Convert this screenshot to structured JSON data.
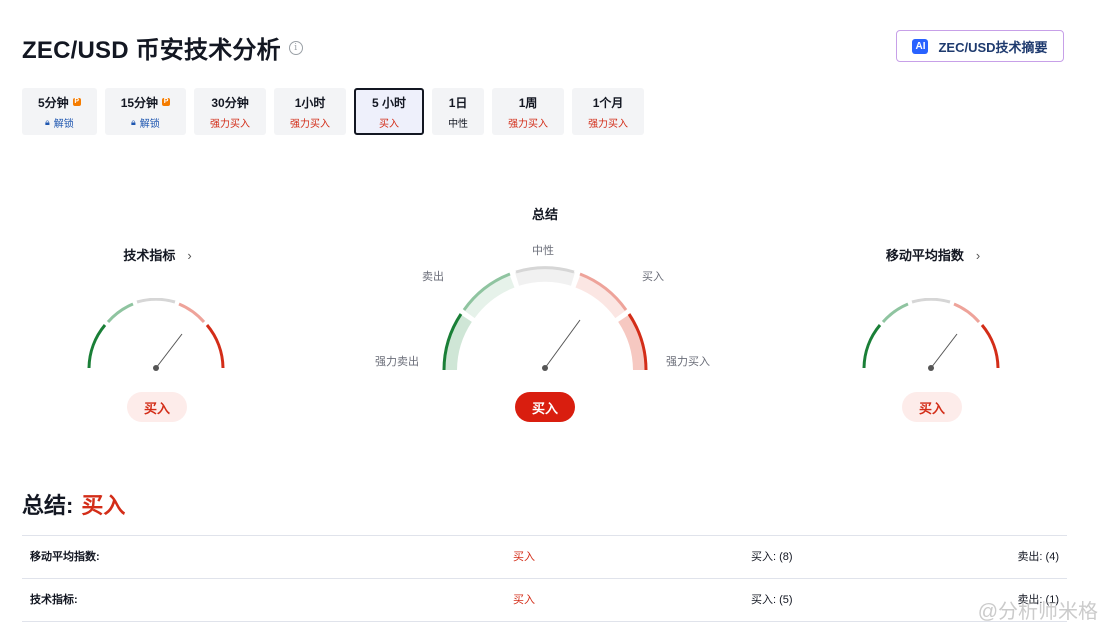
{
  "header": {
    "title": "ZEC/USD 币安技术分析",
    "info_glyph": "i",
    "ai_badge": "AI",
    "ai_button_label": "ZEC/USD技术摘要"
  },
  "timeframes": [
    {
      "label": "5分钟",
      "premium": true,
      "status": "解锁",
      "kind": "locked"
    },
    {
      "label": "15分钟",
      "premium": true,
      "status": "解锁",
      "kind": "locked"
    },
    {
      "label": "30分钟",
      "premium": false,
      "status": "强力买入",
      "kind": "buy"
    },
    {
      "label": "1小时",
      "premium": false,
      "status": "强力买入",
      "kind": "buy"
    },
    {
      "label": "5 小时",
      "premium": false,
      "status": "买入",
      "kind": "buy",
      "active": true
    },
    {
      "label": "1日",
      "premium": false,
      "status": "中性",
      "kind": "neutral"
    },
    {
      "label": "1周",
      "premium": false,
      "status": "强力买入",
      "kind": "buy"
    },
    {
      "label": "1个月",
      "premium": false,
      "status": "强力买入",
      "kind": "buy"
    }
  ],
  "gauges": {
    "technical": {
      "title": "技术指标",
      "chevron": "›",
      "reading": "买入",
      "needle_fraction": 0.7
    },
    "summary": {
      "title": "总结",
      "reading": "买入",
      "needle_fraction": 0.7,
      "labels": {
        "neutral": "中性",
        "sell": "卖出",
        "buy": "买入",
        "strong_sell": "强力卖出",
        "strong_buy": "强力买入"
      }
    },
    "moving_averages": {
      "title": "移动平均指数",
      "chevron": "›",
      "reading": "买入",
      "needle_fraction": 0.7
    }
  },
  "summary": {
    "label": "总结:",
    "value": "买入"
  },
  "table": [
    {
      "name": "移动平均指数:",
      "signal": "买入",
      "buy": "买入: (8)",
      "sell": "卖出: (4)"
    },
    {
      "name": "技术指标:",
      "signal": "买入",
      "buy": "买入: (5)",
      "sell": "卖出: (1)"
    }
  ],
  "watermark": "@分析师米格",
  "colors": {
    "buy": "#d32d18",
    "strong_buy_pill": "#d91e0f",
    "sell_green": "#1a7f37",
    "light_green": "#8fc4a0",
    "light_red": "#eea39a",
    "neutral_grey": "#d6d6d6",
    "accent_blue": "#2962ff"
  },
  "icons": [
    "info-icon",
    "ai-icon",
    "premium-icon",
    "lock-icon",
    "chevron-right-icon"
  ]
}
